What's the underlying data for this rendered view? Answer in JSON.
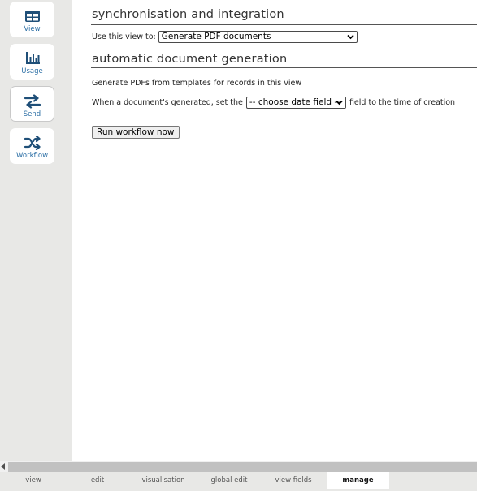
{
  "sidebar": {
    "items": [
      {
        "label": "View",
        "icon": "table-icon"
      },
      {
        "label": "Usage",
        "icon": "bar-chart-icon"
      },
      {
        "label": "Send",
        "icon": "arrows-swap-icon"
      },
      {
        "label": "Workflow",
        "icon": "shuffle-icon"
      }
    ]
  },
  "main": {
    "sync_heading": "synchronisation and integration",
    "use_view_label": "Use this view to:",
    "use_view_value": "Generate PDF documents",
    "docgen_heading": "automatic document generation",
    "description": "Generate PDFs from templates for records in this view",
    "date_prefix": "When a document's generated, set the",
    "date_select_value": "-- choose date field --",
    "date_suffix": "field to the time of creation",
    "run_button": "Run workflow now"
  },
  "tabs": [
    {
      "label": "view"
    },
    {
      "label": "edit"
    },
    {
      "label": "visualisation"
    },
    {
      "label": "global edit"
    },
    {
      "label": "view fields"
    },
    {
      "label": "manage",
      "active": true
    }
  ],
  "colors": {
    "accent": "#2c6fa5",
    "icon": "#1f4f78"
  }
}
